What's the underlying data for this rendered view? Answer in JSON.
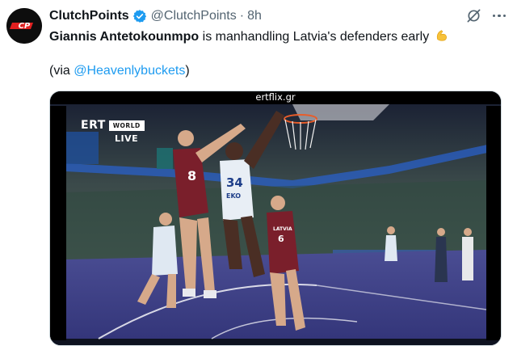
{
  "post": {
    "author_name": "ClutchPoints",
    "author_handle": "@ClutchPoints",
    "separator": "·",
    "time": "8h",
    "avatar_text": "CP",
    "text_bold": "Giannis Antetokounmpo",
    "text_rest": " is manhandling Latvia's defenders early ",
    "via_prefix": "(via ",
    "via_mention": "@Heavenlybuckets",
    "via_suffix": ")"
  },
  "icons": {
    "verified": "verified-badge-icon",
    "grok": "grok-icon",
    "more": "more-icon",
    "emoji": "flexed-biceps-emoji"
  },
  "media": {
    "source_label": "ertflix.gr",
    "broadcaster_logo": "ERT",
    "broadcaster_badge": "WORLD",
    "live_label": "LIVE",
    "player_jerseys": {
      "latvia_left": "8",
      "greece_center": "34",
      "greece_center_name": "EKO",
      "latvia_right": "6",
      "latvia_right_name": "LATVIA"
    }
  },
  "colors": {
    "accent": "#1d9bf0",
    "text": "#0f1419",
    "secondary": "#536471",
    "verified": "#1d9bf0",
    "avatar_red": "#e02020",
    "latvia_jersey": "#7a1f2b",
    "greece_jersey": "#e8eef5",
    "court": "#3d3f8a"
  }
}
